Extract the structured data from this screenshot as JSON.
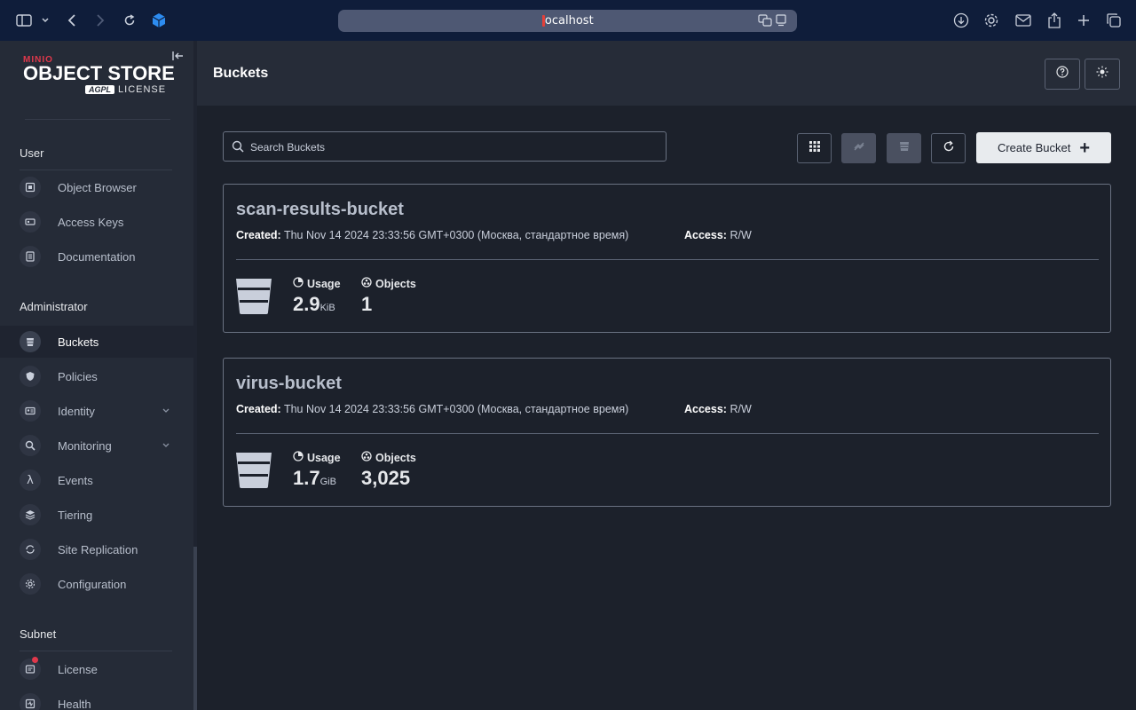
{
  "browser": {
    "url": "localhost"
  },
  "sidebar": {
    "logo": {
      "brand": "MINIO",
      "product": "OBJECT STORE",
      "agpl": "AGPL",
      "license_text": "LICENSE"
    },
    "sections": [
      {
        "label": "User",
        "items": [
          {
            "label": "Object Browser",
            "icon": "object-browser-icon"
          },
          {
            "label": "Access Keys",
            "icon": "access-keys-icon"
          },
          {
            "label": "Documentation",
            "icon": "documentation-icon"
          }
        ]
      },
      {
        "label": "Administrator",
        "items": [
          {
            "label": "Buckets",
            "icon": "bucket-icon",
            "active": true
          },
          {
            "label": "Policies",
            "icon": "policies-icon"
          },
          {
            "label": "Identity",
            "icon": "identity-icon",
            "expandable": true
          },
          {
            "label": "Monitoring",
            "icon": "monitoring-icon",
            "expandable": true
          },
          {
            "label": "Events",
            "icon": "lambda-icon"
          },
          {
            "label": "Tiering",
            "icon": "tiering-icon"
          },
          {
            "label": "Site Replication",
            "icon": "site-replication-icon"
          },
          {
            "label": "Configuration",
            "icon": "gear-icon"
          }
        ]
      },
      {
        "label": "Subnet",
        "items": [
          {
            "label": "License",
            "icon": "license-icon",
            "badge": true
          },
          {
            "label": "Health",
            "icon": "health-icon"
          }
        ]
      }
    ]
  },
  "header": {
    "title": "Buckets"
  },
  "search": {
    "placeholder": "Search Buckets"
  },
  "toolbar": {
    "create_label": "Create Bucket"
  },
  "buckets": [
    {
      "name": "scan-results-bucket",
      "created_label": "Created:",
      "created": "Thu Nov 14 2024 23:33:56 GMT+0300 (Москва, стандартное время)",
      "access_label": "Access:",
      "access": "R/W",
      "usage_label": "Usage",
      "usage_value": "2.9",
      "usage_unit": "KiB",
      "objects_label": "Objects",
      "objects_value": "1"
    },
    {
      "name": "virus-bucket",
      "created_label": "Created:",
      "created": "Thu Nov 14 2024 23:33:56 GMT+0300 (Москва, стандартное время)",
      "access_label": "Access:",
      "access": "R/W",
      "usage_label": "Usage",
      "usage_value": "1.7",
      "usage_unit": "GiB",
      "objects_label": "Objects",
      "objects_value": "3,025"
    }
  ]
}
